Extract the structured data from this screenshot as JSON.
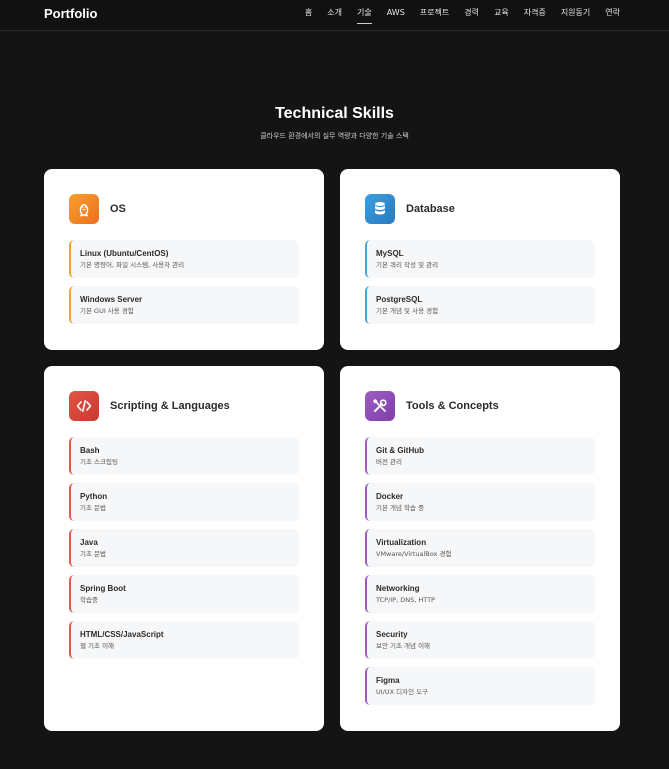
{
  "nav": {
    "brand": "Portfolio",
    "items": [
      "홈",
      "소개",
      "기술",
      "AWS",
      "프로젝트",
      "경력",
      "교육",
      "자격증",
      "지원동기",
      "연락"
    ],
    "active": "기술"
  },
  "section": {
    "title": "Technical Skills",
    "subtitle": "클라우드 환경에서의 실무 역량과 다양한 기술 스택"
  },
  "cards": {
    "os": {
      "title": "OS",
      "icon": "linux-icon",
      "color": "#f08a24",
      "items": [
        {
          "name": "Linux (Ubuntu/CentOS)",
          "desc": "기본 명령어, 파일 시스템, 사용자 관리"
        },
        {
          "name": "Windows Server",
          "desc": "기본 GUI 사용 경험"
        }
      ]
    },
    "db": {
      "title": "Database",
      "icon": "database-icon",
      "color": "#2f8fd3",
      "items": [
        {
          "name": "MySQL",
          "desc": "기본 쿼리 작성 및 관리"
        },
        {
          "name": "PostgreSQL",
          "desc": "기본 개념 및 사용 경험"
        }
      ]
    },
    "script": {
      "title": "Scripting & Languages",
      "icon": "code-icon",
      "color": "#d9453a",
      "items": [
        {
          "name": "Bash",
          "desc": "기초 스크립팅"
        },
        {
          "name": "Python",
          "desc": "기초 문법"
        },
        {
          "name": "Java",
          "desc": "기초 문법"
        },
        {
          "name": "Spring Boot",
          "desc": "학습중"
        },
        {
          "name": "HTML/CSS/JavaScript",
          "desc": "웹 기초 이해"
        }
      ]
    },
    "tools": {
      "title": "Tools & Concepts",
      "icon": "tools-icon",
      "color": "#8e4fb5",
      "items": [
        {
          "name": "Git & GitHub",
          "desc": "버전 관리"
        },
        {
          "name": "Docker",
          "desc": "기본 개념 학습 중"
        },
        {
          "name": "Virtualization",
          "desc": "VMware/VirtualBox 경험"
        },
        {
          "name": "Networking",
          "desc": "TCP/IP, DNS, HTTP"
        },
        {
          "name": "Security",
          "desc": "보안 기초 개념 이해"
        },
        {
          "name": "Figma",
          "desc": "UI/UX 디자인 도구"
        }
      ]
    }
  }
}
